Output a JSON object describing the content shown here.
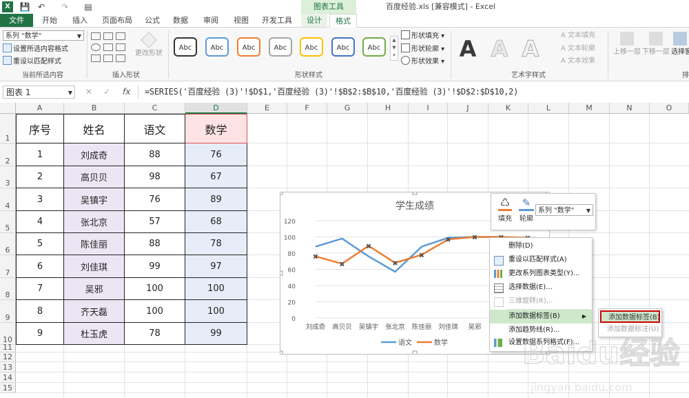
{
  "window": {
    "title": "百度经验.xls  [兼容模式] - Excel",
    "contextual_tools": "图表工具"
  },
  "tabs": [
    {
      "label": "文件",
      "id": "file"
    },
    {
      "label": "开始",
      "id": "home"
    },
    {
      "label": "插入",
      "id": "insert"
    },
    {
      "label": "页面布局",
      "id": "layout"
    },
    {
      "label": "公式",
      "id": "formulas"
    },
    {
      "label": "数据",
      "id": "data"
    },
    {
      "label": "审阅",
      "id": "review"
    },
    {
      "label": "视图",
      "id": "view"
    },
    {
      "label": "开发工具",
      "id": "developer"
    },
    {
      "label": "设计",
      "id": "design"
    },
    {
      "label": "格式",
      "id": "format"
    }
  ],
  "ribbon": {
    "selection_dropdown": "系列 \"数学\"",
    "format_selection": "设置所选内容格式",
    "reset_match_style": "重设以匹配样式",
    "group_current_selection": "当前所选内容",
    "change_shape": "更改形状",
    "group_insert_shapes": "插入形状",
    "abc_label": "Abc",
    "shape_fill": "形状填充",
    "shape_outline": "形状轮廓",
    "shape_effects": "形状效果",
    "group_shape_styles": "形状样式",
    "wordart_letter": "A",
    "text_fill": "文本填充",
    "text_outline": "文本轮廓",
    "text_effects": "文本效果",
    "group_wordart": "艺术字样式",
    "bring_forward": "上移一层",
    "send_backward": "下移一层",
    "selection_pane": "选择窗",
    "group_arrange": "排"
  },
  "shape_style_colors": [
    "#333333",
    "#5b9bd5",
    "#ed7d31",
    "#a5a5a5",
    "#ffc000",
    "#4472c4",
    "#70ad47"
  ],
  "formula_bar": {
    "name_box": "图表 1",
    "fx": "fx",
    "formula": "=SERIES('百度经验 (3)'!$D$1,'百度经验 (3)'!$B$2:$B$10,'百度经验 (3)'!$D$2:$D$10,2)"
  },
  "columns": [
    "A",
    "B",
    "C",
    "D",
    "E",
    "F",
    "G",
    "H",
    "I",
    "J",
    "K",
    "L",
    "M",
    "N",
    "O"
  ],
  "rows": [
    "1",
    "2",
    "3",
    "4",
    "5",
    "6",
    "7",
    "8",
    "9",
    "10",
    "11",
    "12",
    "13",
    "14",
    "15"
  ],
  "table": {
    "headers": [
      "序号",
      "姓名",
      "语文",
      "数学"
    ],
    "rows": [
      [
        "1",
        "刘成奇",
        "88",
        "76"
      ],
      [
        "2",
        "高贝贝",
        "98",
        "67"
      ],
      [
        "3",
        "吴镇宇",
        "76",
        "89"
      ],
      [
        "4",
        "张北京",
        "57",
        "68"
      ],
      [
        "5",
        "陈佳丽",
        "88",
        "78"
      ],
      [
        "6",
        "刘佳琪",
        "99",
        "97"
      ],
      [
        "7",
        "吴邪",
        "100",
        "100"
      ],
      [
        "8",
        "齐天磊",
        "100",
        "100"
      ],
      [
        "9",
        "杜玉虎",
        "78",
        "99"
      ]
    ]
  },
  "chart_data": {
    "type": "line",
    "title": "学生成绩",
    "categories": [
      "刘成奇",
      "高贝贝",
      "吴镇宇",
      "张北京",
      "陈佳丽",
      "刘佳琪",
      "吴邪",
      "齐天磊",
      "杜玉虎"
    ],
    "series": [
      {
        "name": "语文",
        "values": [
          88,
          98,
          76,
          57,
          88,
          99,
          100,
          100,
          78
        ],
        "color": "#5b9bd5"
      },
      {
        "name": "数学",
        "values": [
          76,
          67,
          89,
          68,
          78,
          97,
          100,
          100,
          99
        ],
        "color": "#ed7d31"
      }
    ],
    "ylim": [
      0,
      120
    ],
    "yticks": [
      "0",
      "20",
      "40",
      "60",
      "80",
      "100",
      "120"
    ],
    "visible_category_labels": [
      "刘成奇",
      "高贝贝",
      "吴镇宇",
      "张北京",
      "陈佳丽",
      "刘佳琪",
      "吴邪"
    ],
    "grid": true,
    "legend": "bottom"
  },
  "mini_toolbar": {
    "fill": "填充",
    "outline": "轮廓",
    "series_dropdown": "系列 \"数学\""
  },
  "context_menu": [
    {
      "label": "删除(D)",
      "icon": "delete-icon",
      "disabled": false
    },
    {
      "label": "重设以匹配样式(A)",
      "icon": "reset-style-icon",
      "disabled": false
    },
    {
      "label": "更改系列图表类型(Y)...",
      "icon": "chart-type-icon",
      "disabled": false
    },
    {
      "label": "选择数据(E)...",
      "icon": "select-data-icon",
      "disabled": false
    },
    {
      "label": "三维旋转(R)...",
      "icon": "rotate-3d-icon",
      "disabled": true
    },
    {
      "label": "添加数据标签(B)",
      "icon": "",
      "disabled": false,
      "submenu": true
    },
    {
      "label": "添加趋势线(R)...",
      "icon": "",
      "disabled": false
    },
    {
      "label": "设置数据系列格式(F)...",
      "icon": "format-series-icon",
      "disabled": false
    }
  ],
  "submenu": [
    {
      "label": "添加数据标签(B)",
      "highlighted": true
    },
    {
      "label": "添加数据标注(U)",
      "disabled": true
    }
  ],
  "watermark": {
    "text": "Baidu经验",
    "url": "jingyan.baidu.com"
  }
}
